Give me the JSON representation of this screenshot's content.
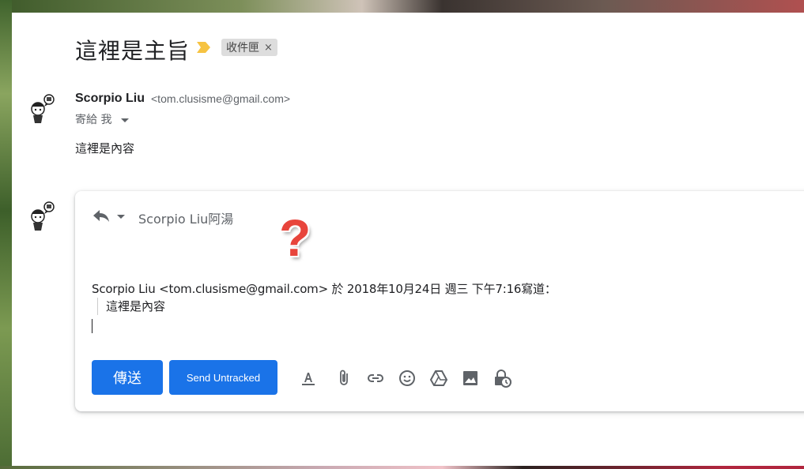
{
  "email": {
    "subject": "這裡是主旨",
    "label_chip": "收件匣",
    "label_close": "×",
    "sender_name": "Scorpio Liu",
    "sender_email": "<tom.clusisme@gmail.com>",
    "to_line": "寄給 我",
    "body": "這裡是內容"
  },
  "reply": {
    "recipient": "Scorpio Liu阿湯",
    "overlay_mark": "?",
    "quote_header": "Scorpio Liu <tom.clusisme@gmail.com> 於 2018年10月24日 週三 下午7:16寫道：",
    "quote_body": "這裡是內容",
    "send_label": "傳送",
    "send_untracked_label": "Send Untracked"
  },
  "toolbar_icons": [
    "format-text-icon",
    "attach-icon",
    "link-icon",
    "emoji-icon",
    "drive-icon",
    "image-icon",
    "confidential-mode-icon"
  ],
  "colors": {
    "accent": "#1a73e8",
    "important_marker": "#f6c342",
    "overlay_mark": "#e8453c"
  }
}
